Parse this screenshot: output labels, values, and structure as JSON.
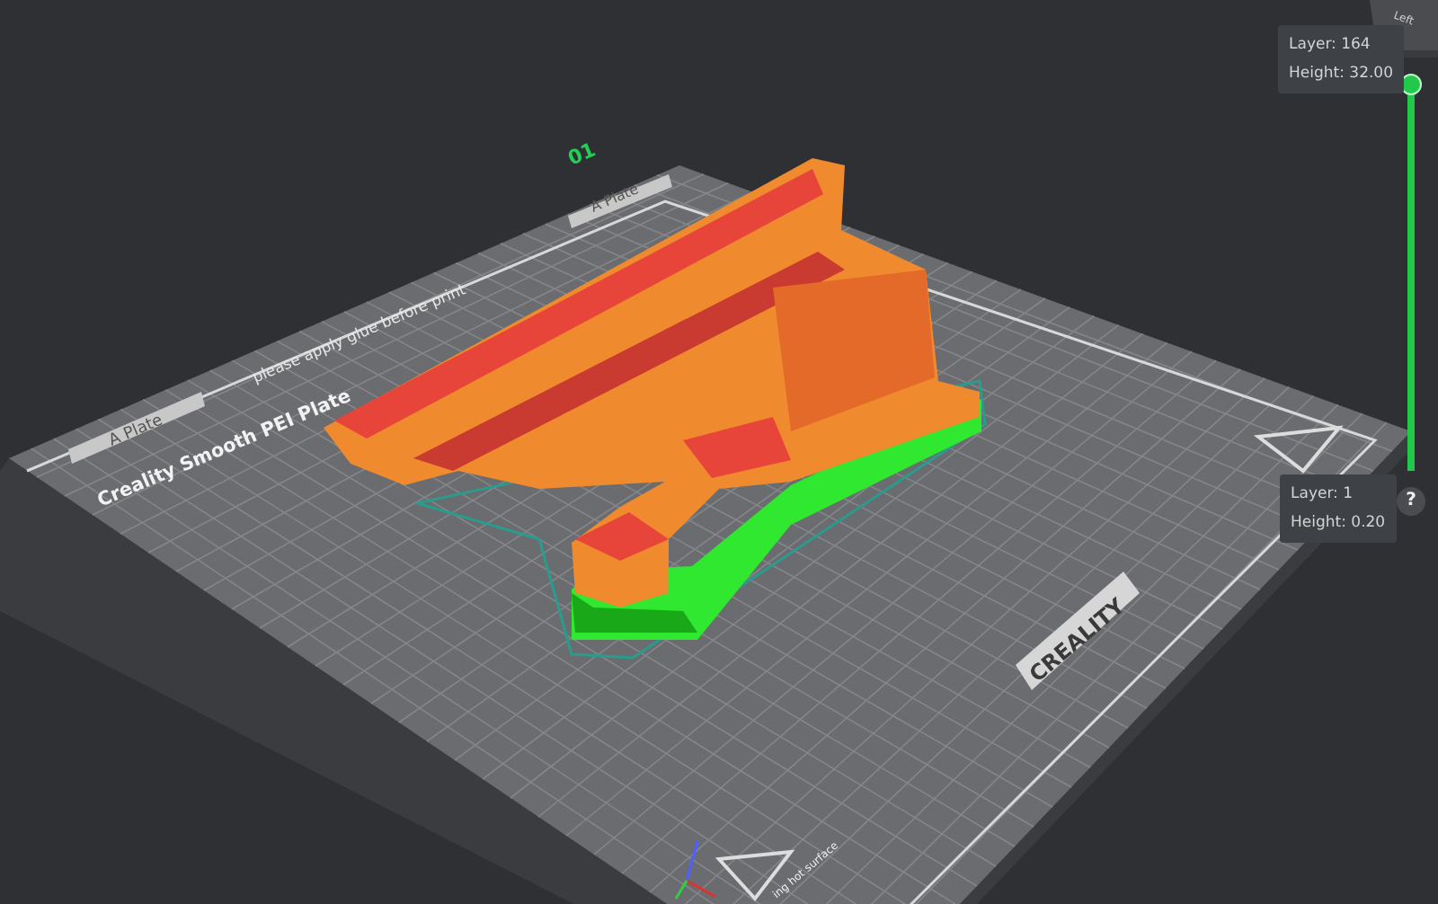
{
  "plate": {
    "number": "01",
    "labels": [
      "A Plate",
      "A Plate"
    ],
    "notice": "please apply glue before print",
    "name": "Creality Smooth PEI Plate",
    "brand": "CREALITY",
    "warning": "ing hot surface"
  },
  "view_cube": {
    "face": "Left"
  },
  "layer_slider": {
    "level": 1,
    "top": {
      "layer": "Layer: 164",
      "height": "Height: 32.00"
    },
    "bottom": {
      "layer": "Layer: 1",
      "height": "Height: 0.20"
    }
  },
  "help_button": "?"
}
